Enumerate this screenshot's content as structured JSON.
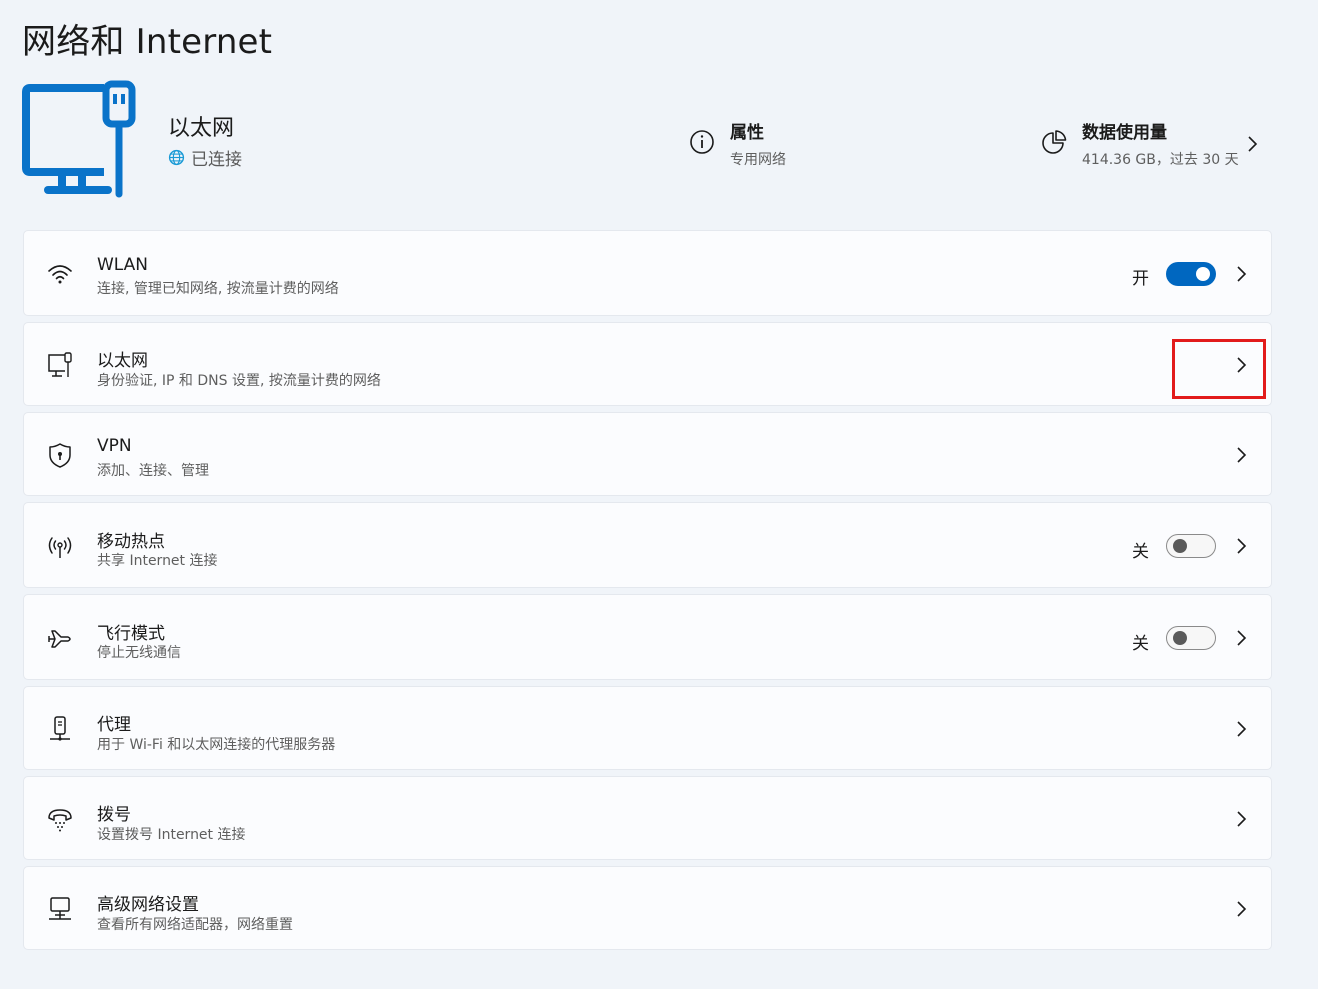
{
  "page": {
    "title": "网络和 Internet"
  },
  "header": {
    "connection": {
      "name": "以太网",
      "status": "已连接"
    },
    "properties": {
      "title": "属性",
      "value": "专用网络",
      "icon": "info-icon"
    },
    "data_usage": {
      "title": "数据使用量",
      "value": "414.36 GB，过去 30 天",
      "icon": "data-usage-pie-icon"
    }
  },
  "items": [
    {
      "id": "wlan",
      "icon": "wifi-icon",
      "title": "WLAN",
      "desc": "连接, 管理已知网络, 按流量计费的网络",
      "state": "开",
      "toggle": true
    },
    {
      "id": "ethernet",
      "icon": "ethernet-icon",
      "title": "以太网",
      "desc": "身份验证, IP 和 DNS 设置, 按流量计费的网络"
    },
    {
      "id": "vpn",
      "icon": "shield-icon",
      "title": "VPN",
      "desc": "添加、连接、管理"
    },
    {
      "id": "hotspot",
      "icon": "hotspot-icon",
      "title": "移动热点",
      "desc": "共享 Internet 连接",
      "state": "关",
      "toggle": false
    },
    {
      "id": "airplane",
      "icon": "airplane-icon",
      "title": "飞行模式",
      "desc": "停止无线通信",
      "state": "关",
      "toggle": false
    },
    {
      "id": "proxy",
      "icon": "proxy-icon",
      "title": "代理",
      "desc": "用于 Wi-Fi 和以太网连接的代理服务器"
    },
    {
      "id": "dialup",
      "icon": "dialup-icon",
      "title": "拨号",
      "desc": "设置拨号 Internet 连接"
    },
    {
      "id": "advanced",
      "icon": "network-computer-icon",
      "title": "高级网络设置",
      "desc": "查看所有网络适配器，网络重置"
    }
  ],
  "colors": {
    "accent": "#0067c0",
    "highlight": "#e21b1b",
    "background": "#f0f4f9"
  }
}
